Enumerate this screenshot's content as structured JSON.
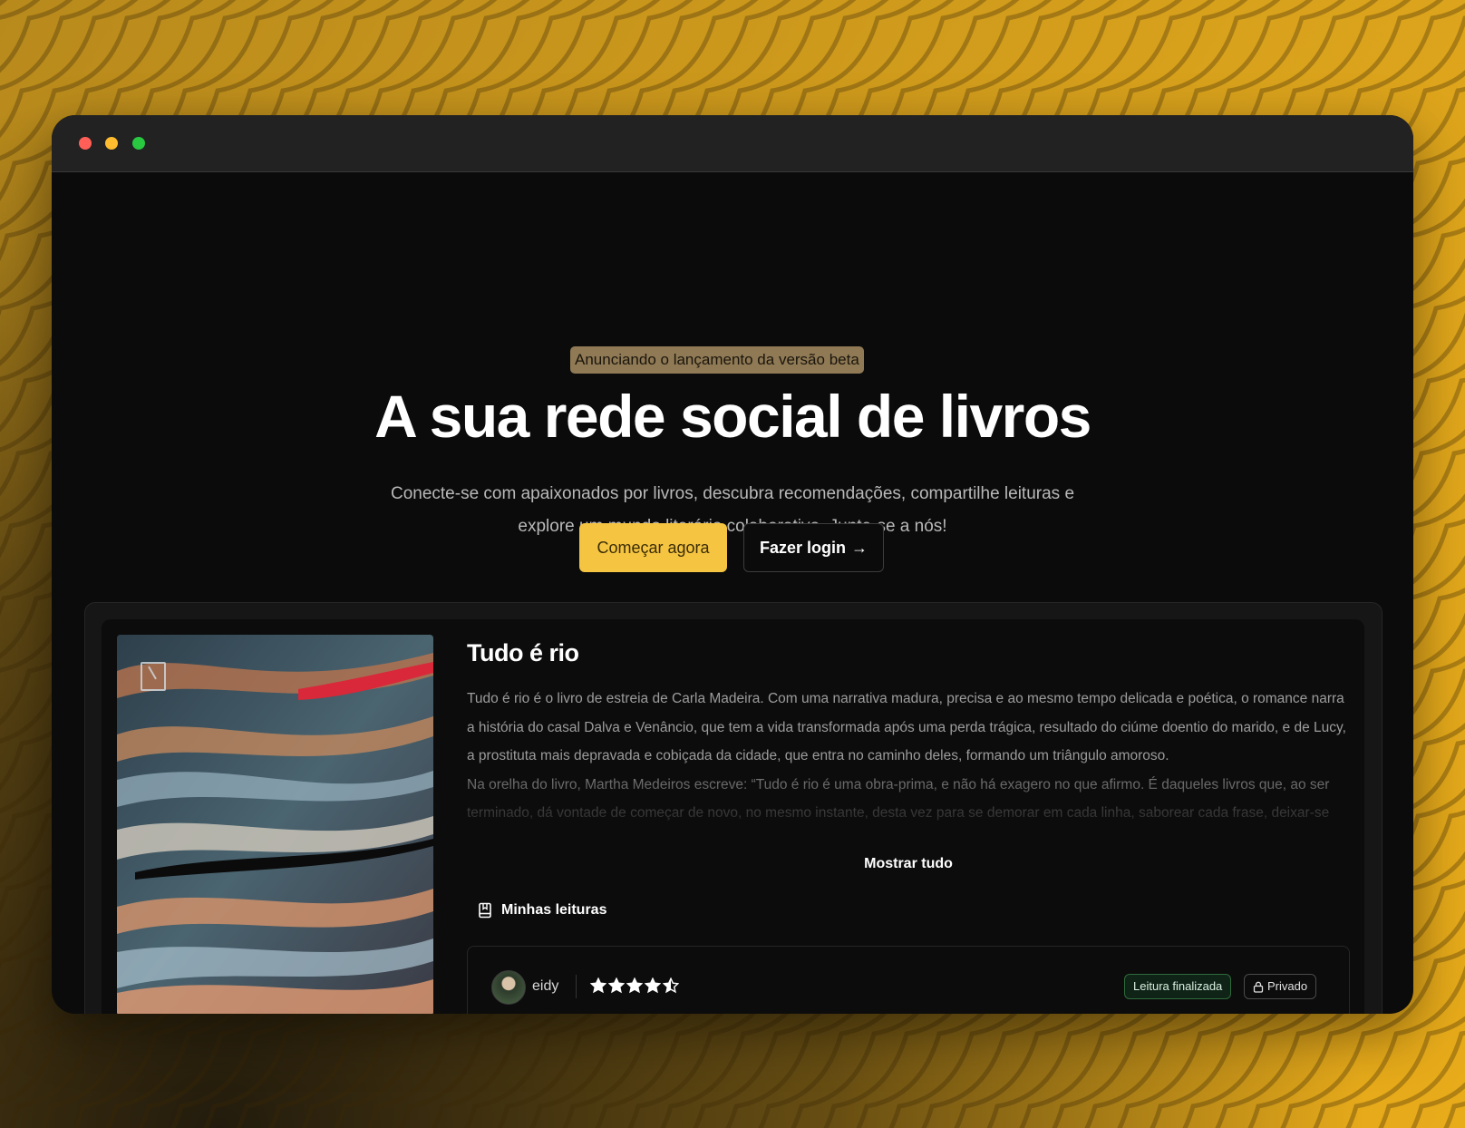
{
  "window": {
    "title": ""
  },
  "hero": {
    "badge": "Anunciando o lançamento da versão beta",
    "headline": "A sua rede social de livros",
    "subtitle_line1": "Conecte-se com apaixonados por livros, descubra recomendações, compartilhe leituras e",
    "subtitle_line2": "explore um mundo literário colaborativo. Junte-se a nós!",
    "primary_cta": "Começar agora",
    "secondary_cta": "Fazer login",
    "secondary_cta_arrow": "→"
  },
  "book": {
    "title": "Tudo é rio",
    "description_p1": "Tudo é rio é o livro de estreia de Carla Madeira. Com uma narrativa madura, precisa e ao mesmo tempo delicada e poética, o romance narra a história do casal Dalva e Venâncio, que tem a vida transformada após uma perda trágica, resultado do ciúme doentio do marido, e de Lucy, a prostituta mais depravada e cobiçada da cidade, que entra no caminho deles, formando um triângulo amoroso.",
    "description_p2": "Na orelha do livro, Martha Medeiros escreve: “Tudo é rio é uma obra-prima, e não há exagero no que afirmo. É daqueles livros que, ao ser terminado, dá vontade de começar de novo, no mesmo instante, desta vez para se demorar em cada linha, saborear cada frase, deixar-se",
    "show_all": "Mostrar tudo",
    "cover_icon": "record-publisher-logo"
  },
  "readings": {
    "section_title": "Minhas leituras",
    "section_icon": "book-icon",
    "entry": {
      "username": "eidy",
      "rating": 4.5,
      "rating_max": 5,
      "status_badge": "Leitura finalizada",
      "privacy_badge": "Privado",
      "privacy_icon": "lock-icon"
    }
  },
  "colors": {
    "accent": "#f5c542",
    "badge_bg": "#8f7a55",
    "window_bg": "#0b0b0b",
    "status_green": "#2e6b3c"
  }
}
